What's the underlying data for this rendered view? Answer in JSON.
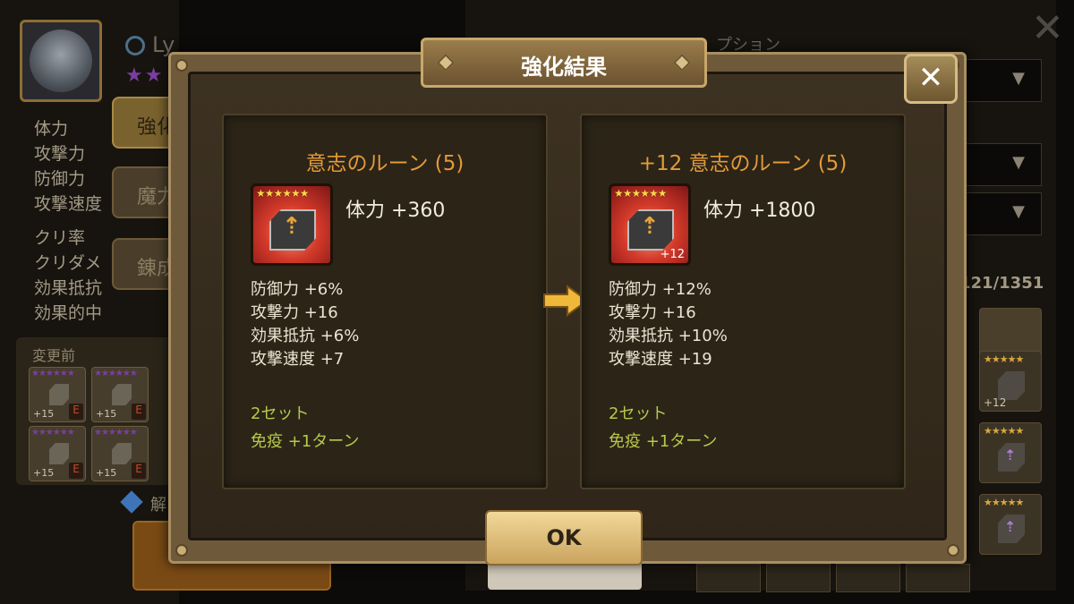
{
  "background": {
    "name_fragment": "Ly",
    "stars": "★★",
    "stats": [
      "体力",
      "攻撃力",
      "防御力",
      "攻撃速度"
    ],
    "stats2": [
      "クリ率",
      "クリダメ",
      "効果抵抗",
      "効果的中"
    ],
    "tabs": [
      "強化",
      "魔力変",
      "錬成"
    ],
    "before_label": "変更前",
    "before_runes": [
      {
        "stars": "★★★★★★",
        "level": "+15",
        "grade": "E"
      },
      {
        "stars": "★★★★★★",
        "level": "+15",
        "grade": "E"
      },
      {
        "stars": "★★★★★★",
        "level": "+15",
        "grade": "E"
      },
      {
        "stars": "★★★★★★",
        "level": "+15",
        "grade": "E"
      }
    ],
    "kai_label": "解",
    "option_label": "プション",
    "rune_count": "121/1351",
    "right_stars": "★★★★★",
    "right_level": "+12"
  },
  "modal": {
    "title": "強化結果",
    "close_label": "✕",
    "ok_label": "OK"
  },
  "before": {
    "title": "意志のルーン (5)",
    "stars": "★★★★★★",
    "glyph": "⇡",
    "main_stat": "体力 +360",
    "sub_stats": [
      "防御力 +6%",
      "攻撃力 +16",
      "効果抵抗 +6%",
      "攻撃速度 +7"
    ],
    "set_bonus": "2セット",
    "set_effect": "免疫 +1ターン"
  },
  "after": {
    "title": "+12 意志のルーン (5)",
    "stars": "★★★★★★",
    "glyph": "⇡",
    "level": "+12",
    "main_stat": "体力 +1800",
    "sub_stats": [
      "防御力 +12%",
      "攻撃力 +16",
      "効果抵抗 +10%",
      "攻撃速度 +19"
    ],
    "set_bonus": "2セット",
    "set_effect": "免疫 +1ターン"
  },
  "colors": {
    "panel_title": "#e39a3a",
    "set_text": "#b6c94a",
    "arrow": "#f0b83a",
    "rune_red": "#d43a2a"
  }
}
